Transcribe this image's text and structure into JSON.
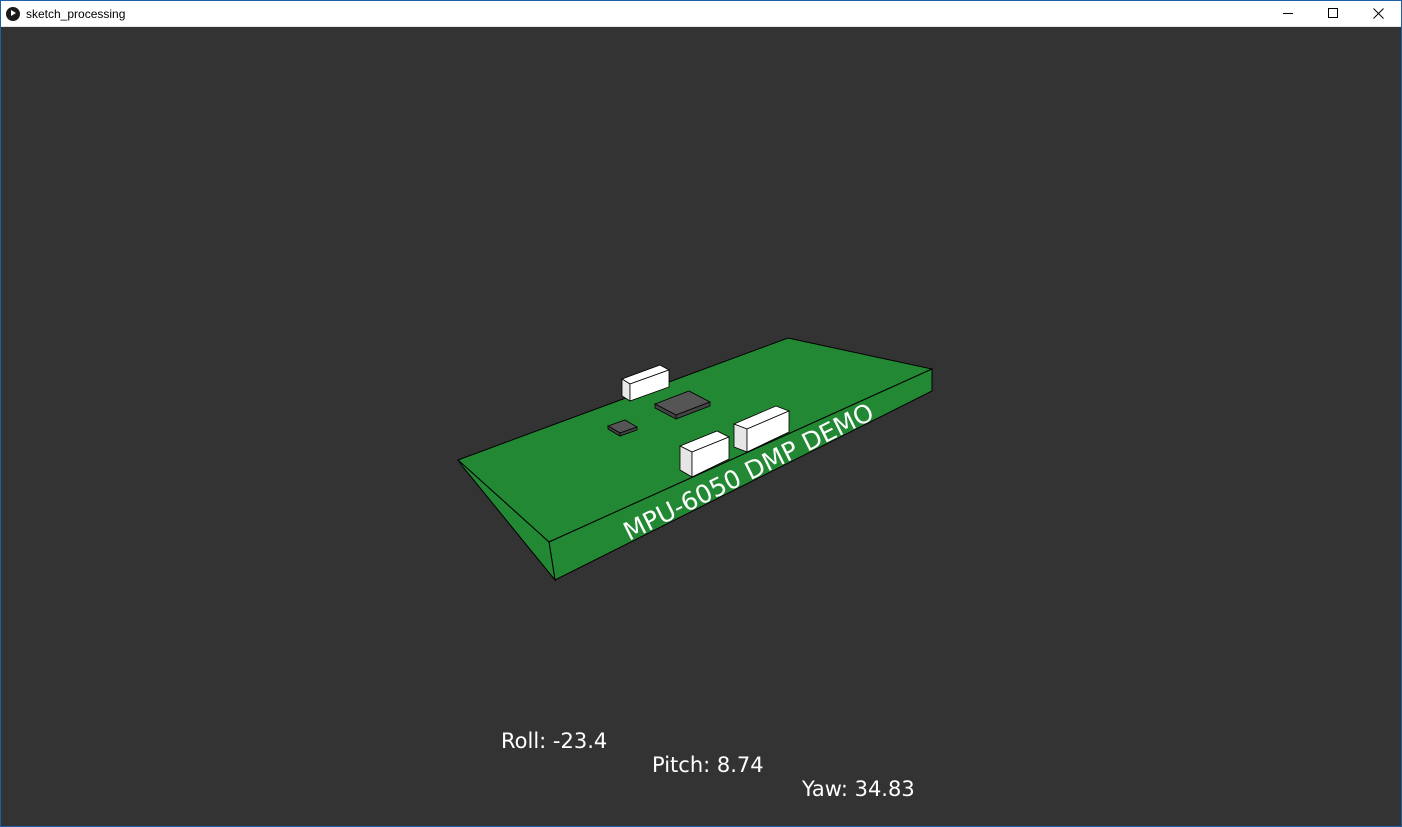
{
  "window": {
    "title": "sketch_processing",
    "controls": {
      "minimize": "minimize-icon",
      "maximize": "maximize-icon",
      "close": "close-icon"
    }
  },
  "scene": {
    "board_label": "MPU-6050 DMP DEMO",
    "board_color": "#228833",
    "background_color": "#333333"
  },
  "readout": {
    "roll": "Roll: -23.4",
    "pitch": "Pitch: 8.74",
    "yaw": "Yaw: 34.83"
  }
}
